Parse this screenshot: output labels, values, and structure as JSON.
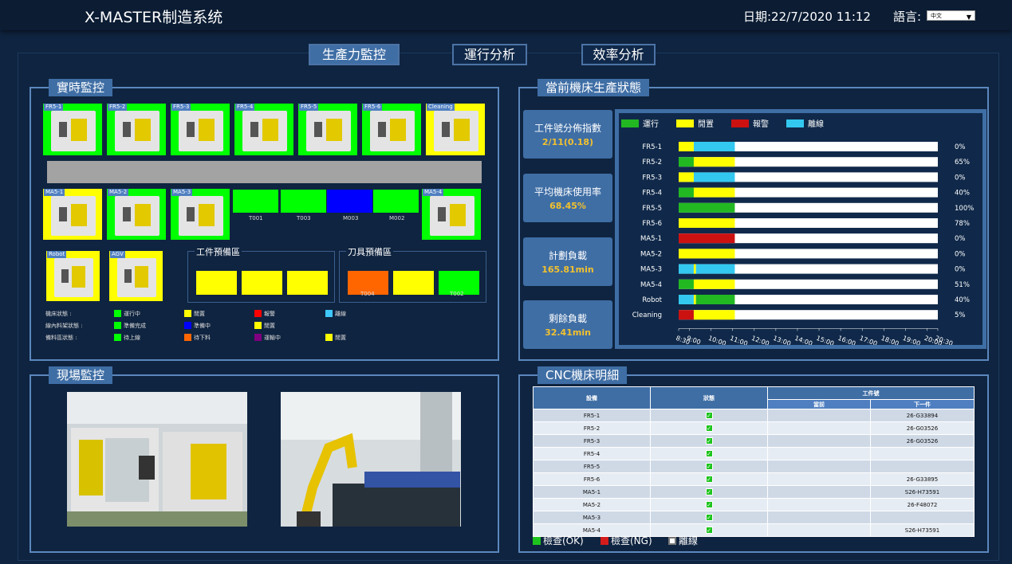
{
  "header": {
    "title": "X-MASTER制造系统",
    "date_label": "日期:22/7/2020 11:12",
    "lang_label": "語言:",
    "lang_value": "中文"
  },
  "tabs": [
    {
      "label": "生產力監控",
      "active": true
    },
    {
      "label": "運行分析",
      "active": false
    },
    {
      "label": "效率分析",
      "active": false
    }
  ],
  "realtime": {
    "title": "實時監控",
    "top_row": [
      {
        "label": "FR5-1",
        "status_color": "#00ff00"
      },
      {
        "label": "FR5-2",
        "status_color": "#00ff00"
      },
      {
        "label": "FR5-3",
        "status_color": "#00ff00"
      },
      {
        "label": "FR5-4",
        "status_color": "#00ff00"
      },
      {
        "label": "FR5-5",
        "status_color": "#00ff00"
      },
      {
        "label": "FR5-6",
        "status_color": "#00ff00"
      },
      {
        "label": "Cleaning",
        "status_color": "#ffff00"
      }
    ],
    "bottom_row": [
      {
        "label": "MA5-1",
        "status_color": "#ffff00"
      },
      {
        "label": "MA5-2",
        "status_color": "#00ff00"
      },
      {
        "label": "MA5-3",
        "status_color": "#00ff00"
      },
      {
        "label": "MA5-4",
        "status_color": "#00ff00"
      }
    ],
    "buffers": [
      {
        "label": "T001",
        "color": "#00ff00"
      },
      {
        "label": "T003",
        "color": "#00ff00"
      },
      {
        "label": "M003",
        "color": "#0000ff"
      },
      {
        "label": "M002",
        "color": "#00ff00"
      }
    ],
    "robots": [
      {
        "label": "Robot",
        "status_color": "#ffff00"
      },
      {
        "label": "AGV",
        "status_color": "#ffff00"
      }
    ],
    "workpiece_area": {
      "title": "工件預備區",
      "slots": [
        "#ffff00",
        "#ffff00",
        "#ffff00"
      ]
    },
    "tool_area": {
      "title": "刀具預備區",
      "slots": [
        {
          "color": "#ff6600",
          "label": "T004"
        },
        {
          "color": "#ffff00",
          "label": ""
        },
        {
          "color": "#00ff00",
          "label": "T002"
        }
      ]
    },
    "legend": [
      {
        "row": "機床狀態 :",
        "items": [
          {
            "label": "運行中",
            "color": "#00ff00"
          },
          {
            "label": "閒置",
            "color": "#ffff00"
          },
          {
            "label": "報警",
            "color": "#ff0000"
          },
          {
            "label": "離線",
            "color": "#3ec8ff"
          }
        ]
      },
      {
        "row": "線內料架狀態 :",
        "items": [
          {
            "label": "準備完成",
            "color": "#00ff00"
          },
          {
            "label": "準備中",
            "color": "#0000ff"
          },
          {
            "label": "閒置",
            "color": "#ffff00"
          }
        ]
      },
      {
        "row": "備料區狀態 :",
        "items": [
          {
            "label": "待上線",
            "color": "#00ff00"
          },
          {
            "label": "待下料",
            "color": "#ff6600"
          },
          {
            "label": "運輸中",
            "color": "#800080"
          },
          {
            "label": "閒置",
            "color": "#ffff00"
          }
        ]
      }
    ]
  },
  "site": {
    "title": "現場監控"
  },
  "production": {
    "title": "當前機床生產狀態",
    "kpis": [
      {
        "label": "工件號分佈指數",
        "value": "2/11(0.18)"
      },
      {
        "label": "平均機床使用率",
        "value": "68.45%"
      },
      {
        "label": "計劃負載",
        "value": "165.81min"
      },
      {
        "label": "剩餘負載",
        "value": "32.41min"
      }
    ]
  },
  "chart_data": {
    "type": "bar",
    "orientation": "horizontal-stacked-timeline",
    "legend": [
      {
        "name": "運行",
        "color": "#22b822"
      },
      {
        "name": "閒置",
        "color": "#ffff00"
      },
      {
        "name": "報警",
        "color": "#cc1111"
      },
      {
        "name": "離線",
        "color": "#33c8f0"
      }
    ],
    "x_ticks": [
      "8:30",
      "9:00",
      "10:00",
      "11:00",
      "12:00",
      "13:00",
      "14:00",
      "15:00",
      "16:00",
      "17:00",
      "18:00",
      "19:00",
      "20:00",
      "20:30"
    ],
    "xlim": [
      8.5,
      20.5
    ],
    "rows": [
      {
        "name": "FR5-1",
        "pct": "0%",
        "segments": [
          {
            "s": "閒置",
            "from": 8.5,
            "to": 9.2
          },
          {
            "s": "離線",
            "from": 9.2,
            "to": 11.1
          }
        ]
      },
      {
        "name": "FR5-2",
        "pct": "65%",
        "segments": [
          {
            "s": "運行",
            "from": 8.5,
            "to": 9.2
          },
          {
            "s": "閒置",
            "from": 9.2,
            "to": 11.1
          }
        ]
      },
      {
        "name": "FR5-3",
        "pct": "0%",
        "segments": [
          {
            "s": "閒置",
            "from": 8.5,
            "to": 9.2
          },
          {
            "s": "離線",
            "from": 9.2,
            "to": 11.1
          }
        ]
      },
      {
        "name": "FR5-4",
        "pct": "40%",
        "segments": [
          {
            "s": "運行",
            "from": 8.5,
            "to": 9.2
          },
          {
            "s": "閒置",
            "from": 9.2,
            "to": 11.1
          }
        ]
      },
      {
        "name": "FR5-5",
        "pct": "100%",
        "segments": [
          {
            "s": "運行",
            "from": 8.5,
            "to": 11.1
          }
        ]
      },
      {
        "name": "FR5-6",
        "pct": "78%",
        "segments": [
          {
            "s": "閒置",
            "from": 8.5,
            "to": 11.1
          }
        ]
      },
      {
        "name": "MA5-1",
        "pct": "0%",
        "segments": [
          {
            "s": "報警",
            "from": 8.5,
            "to": 11.1
          }
        ]
      },
      {
        "name": "MA5-2",
        "pct": "0%",
        "segments": [
          {
            "s": "閒置",
            "from": 8.5,
            "to": 11.1
          }
        ]
      },
      {
        "name": "MA5-3",
        "pct": "0%",
        "segments": [
          {
            "s": "離線",
            "from": 8.5,
            "to": 9.2
          },
          {
            "s": "閒置",
            "from": 9.2,
            "to": 9.3
          },
          {
            "s": "離線",
            "from": 9.3,
            "to": 11.1
          }
        ]
      },
      {
        "name": "MA5-4",
        "pct": "51%",
        "segments": [
          {
            "s": "運行",
            "from": 8.5,
            "to": 9.2
          },
          {
            "s": "閒置",
            "from": 9.2,
            "to": 11.1
          }
        ]
      },
      {
        "name": "Robot",
        "pct": "40%",
        "segments": [
          {
            "s": "離線",
            "from": 8.5,
            "to": 9.2
          },
          {
            "s": "閒置",
            "from": 9.2,
            "to": 9.3
          },
          {
            "s": "運行",
            "from": 9.3,
            "to": 11.1
          }
        ]
      },
      {
        "name": "Cleaning",
        "pct": "5%",
        "segments": [
          {
            "s": "報警",
            "from": 8.5,
            "to": 9.2
          },
          {
            "s": "閒置",
            "from": 9.2,
            "to": 11.1
          }
        ]
      }
    ]
  },
  "cnc": {
    "title": "CNC機床明細",
    "headers": {
      "device": "設備",
      "status": "狀態",
      "workpiece": "工件號",
      "current": "當前",
      "next": "下一件"
    },
    "rows": [
      {
        "device": "FR5-1",
        "current": "",
        "next": "26-G33894"
      },
      {
        "device": "FR5-2",
        "current": "",
        "next": "26-G03526"
      },
      {
        "device": "FR5-3",
        "current": "",
        "next": "26-G03526"
      },
      {
        "device": "FR5-4",
        "current": "",
        "next": ""
      },
      {
        "device": "FR5-5",
        "current": "",
        "next": ""
      },
      {
        "device": "FR5-6",
        "current": "",
        "next": "26-G33895"
      },
      {
        "device": "MA5-1",
        "current": "",
        "next": "S26-H73591"
      },
      {
        "device": "MA5-2",
        "current": "",
        "next": "26-F48072"
      },
      {
        "device": "MA5-3",
        "current": "",
        "next": ""
      },
      {
        "device": "MA5-4",
        "current": "",
        "next": "S26-H73591"
      }
    ],
    "legend": {
      "ok": "檢查(OK)",
      "ng": "檢查(NG)",
      "offline": "離線"
    }
  }
}
